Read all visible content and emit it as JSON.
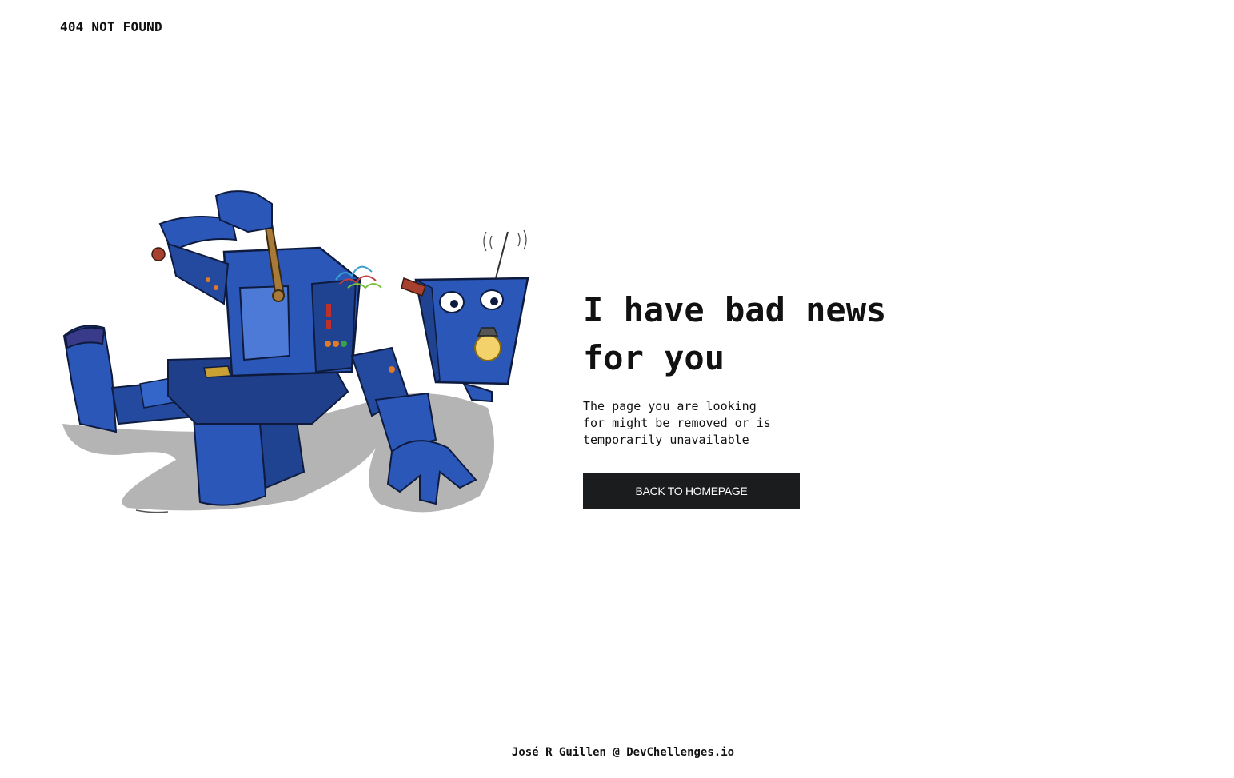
{
  "header": {
    "brand": "404 NOT FOUND"
  },
  "main": {
    "headline": "I have bad news for you",
    "description": "The page you are looking for might be removed or is temporarily unavailable",
    "button_label": "BACK TO HOMEPAGE"
  },
  "illustration": {
    "icon": "broken-robot-illustration"
  },
  "footer": {
    "credit": "José R Guillen @ DevChellenges.io"
  },
  "colors": {
    "robot_blue": "#2b58b8",
    "robot_dark": "#152a63",
    "button_bg": "#1b1c1e",
    "shadow": "#b3b3b3"
  }
}
